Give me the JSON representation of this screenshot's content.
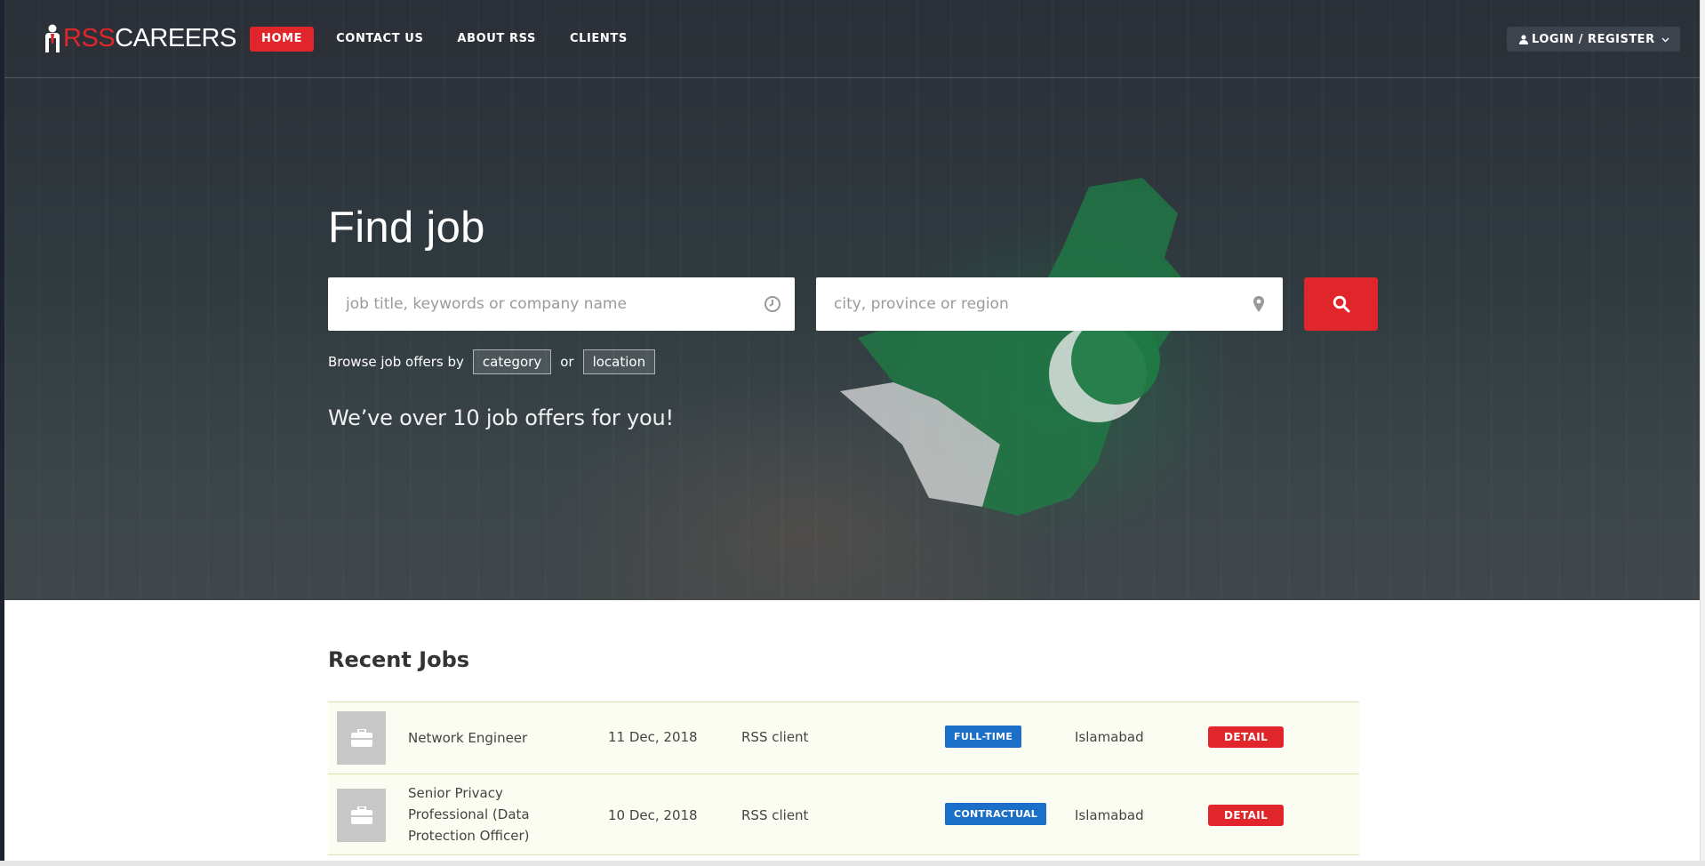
{
  "brand": {
    "rss": "RSS",
    "careers": "CAREERS"
  },
  "nav": {
    "items": [
      {
        "label": "HOME",
        "active": true
      },
      {
        "label": "CONTACT US",
        "active": false
      },
      {
        "label": "ABOUT RSS",
        "active": false
      },
      {
        "label": "CLIENTS",
        "active": false
      }
    ]
  },
  "login": {
    "label": "LOGIN / REGISTER",
    "icon": "user-icon"
  },
  "hero": {
    "title": "Find job",
    "keyword_placeholder": "job title, keywords or company name",
    "location_placeholder": "city, province or region",
    "keyword_icon": "clock-icon",
    "location_icon": "map-pin-icon",
    "search_icon": "search-icon",
    "browse_prefix": "Browse job offers by",
    "browse_category": "category",
    "browse_or": "or",
    "browse_location": "location",
    "offers_text": "We’ve over 10 job offers for you!"
  },
  "recent": {
    "title": "Recent Jobs",
    "jobs": [
      {
        "title": "Network Engineer",
        "date": "11 Dec, 2018",
        "company": "RSS client",
        "type": "FULL-TIME",
        "location": "Islamabad",
        "action": "DETAIL"
      },
      {
        "title": "Senior Privacy Professional (Data Protection Officer)",
        "date": "10 Dec, 2018",
        "company": "RSS client",
        "type": "CONTRACTUAL",
        "location": "Islamabad",
        "action": "DETAIL"
      }
    ]
  },
  "colors": {
    "accent": "#e0262a",
    "badge": "#1b6fc8",
    "row_bg": "#fcfdf2"
  }
}
